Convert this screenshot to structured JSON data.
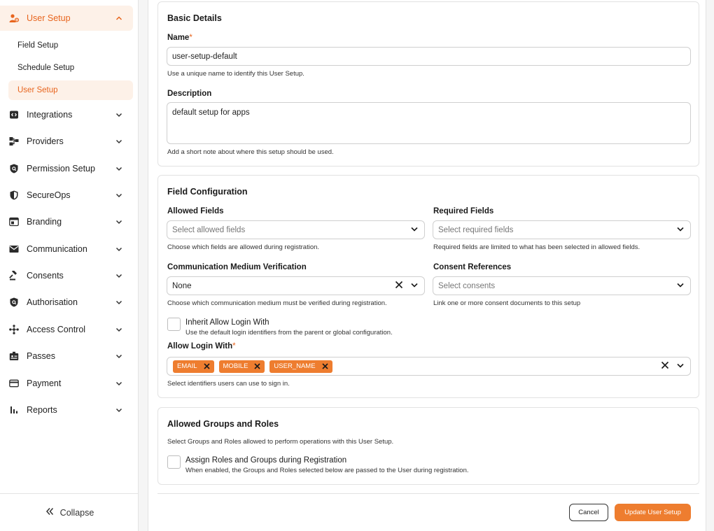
{
  "sidebar": {
    "user_setup": {
      "label": "User Setup",
      "icon": "user-gear-icon"
    },
    "sub_items": [
      {
        "label": "Field Setup"
      },
      {
        "label": "Schedule Setup"
      },
      {
        "label": "User Setup"
      }
    ],
    "items": [
      {
        "label": "Integrations",
        "icon": "integration-icon"
      },
      {
        "label": "Providers",
        "icon": "providers-icon"
      },
      {
        "label": "Permission Setup",
        "icon": "shield-search-icon"
      },
      {
        "label": "SecureOps",
        "icon": "shield-icon"
      },
      {
        "label": "Branding",
        "icon": "branding-icon"
      },
      {
        "label": "Communication",
        "icon": "mail-icon"
      },
      {
        "label": "Consents",
        "icon": "gavel-icon"
      },
      {
        "label": "Authorisation",
        "icon": "shield-search-icon"
      },
      {
        "label": "Access Control",
        "icon": "access-control-icon"
      },
      {
        "label": "Passes",
        "icon": "badge-icon"
      },
      {
        "label": "Payment",
        "icon": "card-icon"
      },
      {
        "label": "Reports",
        "icon": "bar-chart-icon"
      }
    ],
    "collapse_label": "Collapse"
  },
  "basic": {
    "title": "Basic Details",
    "name_label": "Name",
    "required_mark": "*",
    "name_value": "user-setup-default",
    "name_hint": "Use a unique name to identify this User Setup.",
    "description_label": "Description",
    "description_value": "default setup for apps",
    "description_hint": "Add a short note about where this setup should be used."
  },
  "fields": {
    "title": "Field Configuration",
    "allowed_label": "Allowed Fields",
    "allowed_placeholder": "Select allowed fields",
    "allowed_hint": "Choose which fields are allowed during registration.",
    "required_label": "Required Fields",
    "required_placeholder": "Select required fields",
    "required_hint": "Required fields are limited to what has been selected in allowed fields.",
    "verification_label": "Communication Medium Verification",
    "verification_value": "None",
    "verification_hint": "Choose which communication medium must be verified during registration.",
    "consent_label": "Consent References",
    "consent_placeholder": "Select consents",
    "consent_hint": "Link one or more consent documents to this setup",
    "inherit_label": "Inherit Allow Login With",
    "inherit_hint": "Use the default login identifiers from the parent or global configuration.",
    "login_with_label": "Allow Login With",
    "login_chips": [
      "EMAIL",
      "MOBILE",
      "USER_NAME"
    ],
    "login_hint": "Select identifiers users can use to sign in."
  },
  "groups": {
    "title": "Allowed Groups and Roles",
    "description": "Select Groups and Roles allowed to perform operations with this User Setup.",
    "assign_label": "Assign Roles and Groups during Registration",
    "assign_hint": "When enabled, the Groups and Roles selected below are passed to the User during registration."
  },
  "actions": {
    "cancel_label": "Cancel",
    "submit_label": "Update User Setup"
  },
  "colors": {
    "accent": "#ee7d2f",
    "accent_text": "#e8651e",
    "active_bg": "#fdf1e8"
  }
}
